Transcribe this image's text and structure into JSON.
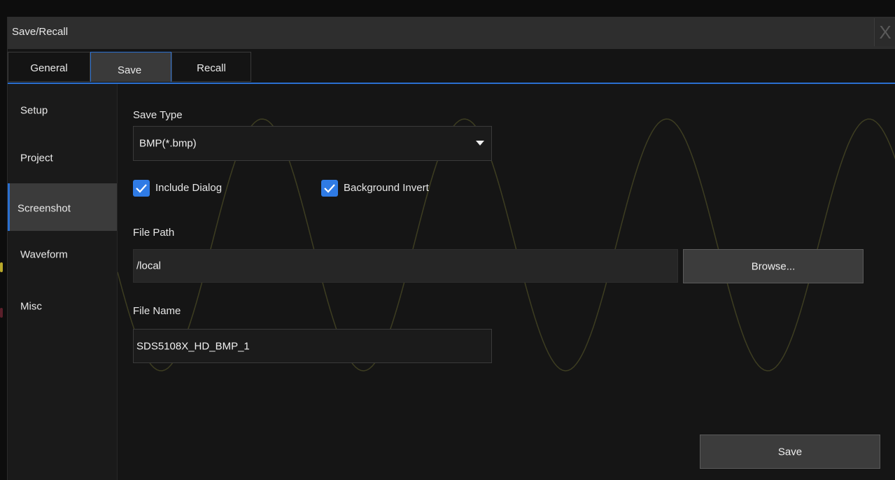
{
  "window": {
    "title": "Save/Recall",
    "close_label": "X"
  },
  "tabs": [
    {
      "label": "General",
      "active": false
    },
    {
      "label": "Save",
      "active": true
    },
    {
      "label": "Recall",
      "active": false
    }
  ],
  "sidebar": {
    "items": [
      {
        "label": "Setup",
        "active": false
      },
      {
        "label": "Project",
        "active": false
      },
      {
        "label": "Screenshot",
        "active": true
      },
      {
        "label": "Waveform",
        "active": false
      },
      {
        "label": "Misc",
        "active": false
      }
    ]
  },
  "form": {
    "save_type_label": "Save Type",
    "save_type_value": "BMP(*.bmp)",
    "include_dialog": {
      "label": "Include Dialog",
      "checked": true
    },
    "background_invert": {
      "label": "Background Invert",
      "checked": true
    },
    "file_path_label": "File Path",
    "file_path_value": "/local",
    "browse_label": "Browse...",
    "file_name_label": "File Name",
    "file_name_value": "SDS5108X_HD_BMP_1",
    "save_label": "Save"
  },
  "colors": {
    "accent": "#2a6fd0",
    "checkbox": "#2f7be5",
    "waveform": "#8a8a3a"
  }
}
